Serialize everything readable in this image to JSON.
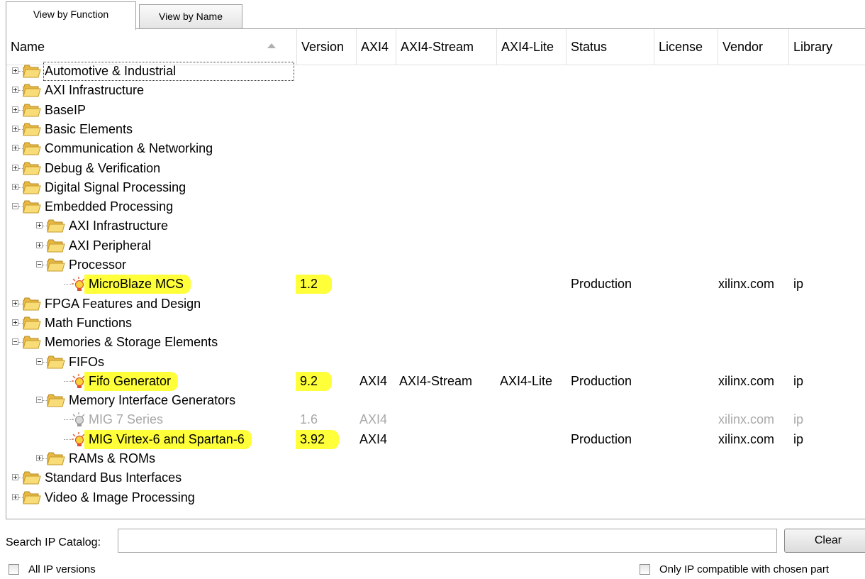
{
  "tabs": [
    "View by Function",
    "View by Name"
  ],
  "columns": [
    "Name",
    "Version",
    "AXI4",
    "AXI4-Stream",
    "AXI4-Lite",
    "Status",
    "License",
    "Vendor",
    "Library"
  ],
  "rows": [
    {
      "label": "Automotive & Industrial",
      "level": 0,
      "type": "folder",
      "expanded": false,
      "focused": true
    },
    {
      "label": "AXI Infrastructure",
      "level": 0,
      "type": "folder",
      "expanded": false
    },
    {
      "label": "BaseIP",
      "level": 0,
      "type": "folder",
      "expanded": false
    },
    {
      "label": "Basic Elements",
      "level": 0,
      "type": "folder",
      "expanded": false
    },
    {
      "label": "Communication & Networking",
      "level": 0,
      "type": "folder",
      "expanded": false
    },
    {
      "label": "Debug & Verification",
      "level": 0,
      "type": "folder",
      "expanded": false
    },
    {
      "label": "Digital Signal Processing",
      "level": 0,
      "type": "folder",
      "expanded": false
    },
    {
      "label": "Embedded Processing",
      "level": 0,
      "type": "folder",
      "expanded": true
    },
    {
      "label": "AXI Infrastructure",
      "level": 1,
      "type": "folder",
      "expanded": false
    },
    {
      "label": "AXI Peripheral",
      "level": 1,
      "type": "folder",
      "expanded": false
    },
    {
      "label": "Processor",
      "level": 1,
      "type": "folder",
      "expanded": true
    },
    {
      "label": "MicroBlaze MCS",
      "level": 2,
      "type": "ip",
      "highlighted": true,
      "version": "1.2",
      "axi4": "",
      "axi4stream": "",
      "axi4lite": "",
      "status": "Production",
      "license": "",
      "vendor": "xilinx.com",
      "library": "ip"
    },
    {
      "label": "FPGA Features and Design",
      "level": 0,
      "type": "folder",
      "expanded": false
    },
    {
      "label": "Math Functions",
      "level": 0,
      "type": "folder",
      "expanded": false
    },
    {
      "label": "Memories & Storage Elements",
      "level": 0,
      "type": "folder",
      "expanded": true
    },
    {
      "label": "FIFOs",
      "level": 1,
      "type": "folder",
      "expanded": true
    },
    {
      "label": "Fifo Generator",
      "level": 2,
      "type": "ip",
      "highlighted": true,
      "version": "9.2",
      "axi4": "AXI4",
      "axi4stream": "AXI4-Stream",
      "axi4lite": "AXI4-Lite",
      "status": "Production",
      "license": "",
      "vendor": "xilinx.com",
      "library": "ip"
    },
    {
      "label": "Memory Interface Generators",
      "level": 1,
      "type": "folder",
      "expanded": true
    },
    {
      "label": "MIG 7 Series",
      "level": 2,
      "type": "ip",
      "disabled": true,
      "version": "1.6",
      "axi4": "AXI4",
      "axi4stream": "",
      "axi4lite": "",
      "status": "",
      "license": "",
      "vendor": "xilinx.com",
      "library": "ip"
    },
    {
      "label": "MIG Virtex-6 and Spartan-6",
      "level": 2,
      "type": "ip",
      "highlighted": true,
      "version": "3.92",
      "axi4": "AXI4",
      "axi4stream": "",
      "axi4lite": "",
      "status": "Production",
      "license": "",
      "vendor": "xilinx.com",
      "library": "ip"
    },
    {
      "label": "RAMs & ROMs",
      "level": 1,
      "type": "folder",
      "expanded": false
    },
    {
      "label": "Standard Bus Interfaces",
      "level": 0,
      "type": "folder",
      "expanded": false
    },
    {
      "label": "Video & Image Processing",
      "level": 0,
      "type": "folder",
      "expanded": false
    }
  ],
  "search": {
    "label": "Search IP Catalog:",
    "value": "",
    "placeholder": ""
  },
  "clear_label": "Clear",
  "checkboxes": {
    "all_versions": {
      "label": "All IP versions",
      "checked": false
    },
    "compatible": {
      "label": "Only IP compatible with chosen part",
      "checked": false
    }
  },
  "colors": {
    "highlight": "#ffff3a",
    "folder": "#f5d76a",
    "disabled_text": "#a8a8a8"
  },
  "icons": {
    "folder": "folder-icon",
    "ip": "ip-core-bulb-icon",
    "expand": "plus-expander-icon",
    "collapse": "minus-expander-icon"
  }
}
